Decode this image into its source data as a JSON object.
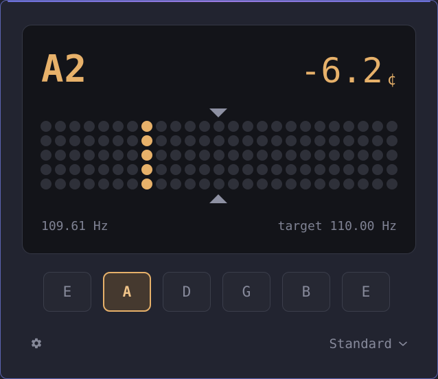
{
  "display": {
    "note": "A2",
    "cents_value": "-6.2",
    "cents_unit": "¢",
    "frequency": "109.61 Hz",
    "target": "target 110.00 Hz",
    "meter": {
      "columns": 25,
      "rows": 5,
      "active_column": 7
    }
  },
  "strings": [
    {
      "label": "E",
      "active": false
    },
    {
      "label": "A",
      "active": true
    },
    {
      "label": "D",
      "active": false
    },
    {
      "label": "G",
      "active": false
    },
    {
      "label": "B",
      "active": false
    },
    {
      "label": "E",
      "active": false
    }
  ],
  "footer": {
    "settings_icon": "gear-icon",
    "tuning_label": "Standard",
    "tuning_icon": "chevron-down-icon"
  },
  "colors": {
    "accent": "#e7b16a",
    "border": "#5b63b0"
  }
}
